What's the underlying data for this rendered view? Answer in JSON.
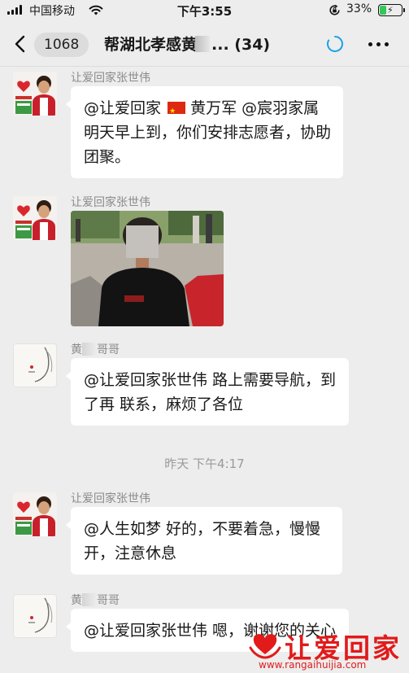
{
  "status_bar": {
    "carrier": "中国移动",
    "time": "下午3:55",
    "battery_percent": "33%",
    "battery_level": 0.33
  },
  "nav": {
    "unread_count": "1068",
    "title_prefix": "帮湖北孝感黄",
    "title_suffix": "... (34)",
    "icons": [
      "chevron-left",
      "loading-circle",
      "more-dots"
    ]
  },
  "messages": [
    {
      "sender": "让爱回家张世伟",
      "text_before_flag": "@让爱回家",
      "text_after_flag": "黄万军 @宸羽家属明天早上到，你们安排志愿者，协助团聚。"
    },
    {
      "sender": "让爱回家张世伟",
      "type": "image"
    },
    {
      "sender_prefix": "黄",
      "sender_suffix": "哥哥",
      "text": "@让爱回家张世伟 路上需要导航，到了再 联系，麻烦了各位"
    },
    {
      "sender": "让爱回家张世伟",
      "text": "@人生如梦 好的，不要着急，慢慢开，注意休息"
    },
    {
      "sender_prefix": "黄",
      "sender_suffix": "哥哥",
      "text": "@让爱回家张世伟 嗯，谢谢您的关心"
    }
  ],
  "timestamp": "昨天 下午4:17",
  "watermark": {
    "brand": "让爱回家",
    "url": "www.rangaihuijia.com"
  },
  "colors": {
    "background": "#ededed",
    "bubble": "#ffffff",
    "accent_blue": "#1aa1e8",
    "brand_red": "#e21a1a",
    "battery_green": "#34c759"
  }
}
